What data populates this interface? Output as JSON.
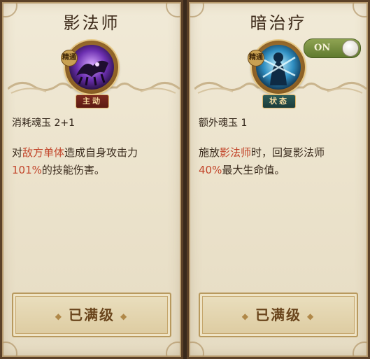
{
  "left_card": {
    "title": "影法师",
    "badge_top": "精通",
    "type_label": "主动",
    "cost": "消耗魂玉 2+1",
    "desc": {
      "part1": "对",
      "hl1": "敌方单体",
      "part2": "造成自身攻击力",
      "hl2": "101%",
      "part3": "的技能伤害。"
    },
    "max_label": "已满级"
  },
  "right_card": {
    "title": "暗治疗",
    "badge_top": "精通",
    "type_label": "状态",
    "cost": "额外魂玉 1",
    "toggle_label": "ON",
    "desc": {
      "part1": "施放",
      "hl1": "影法师",
      "part2": "时，回复影法师",
      "hl2": "40%",
      "part3": "最大生命值。"
    },
    "max_label": "已满级"
  },
  "colors": {
    "highlight": "#c2452a",
    "text": "#3a2b1d",
    "toggle_on": "#7a9140"
  },
  "icons": {
    "left_skill": "shadow-mage-icon",
    "right_skill": "dark-heal-icon",
    "decor": "diamond-dot-icon"
  }
}
